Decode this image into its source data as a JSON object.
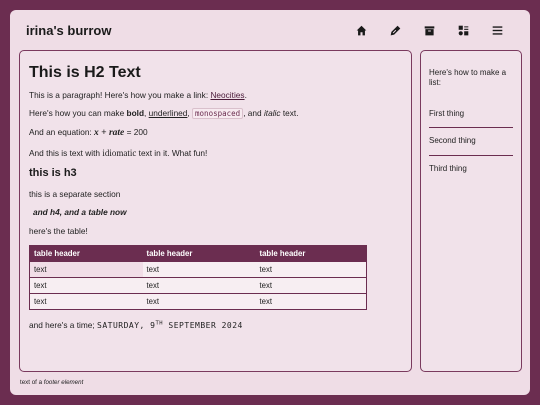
{
  "header": {
    "site_title": "irina's burrow",
    "nav": [
      "home-icon",
      "pen-icon",
      "archive-icon",
      "shapes-icon",
      "menu-icon"
    ]
  },
  "main": {
    "h2": "This is H2 Text",
    "p1_prefix": "This is a paragraph! Here's how you make a link: ",
    "p1_link": "Neocities",
    "p1_suffix": ".",
    "p2_prefix": "Here's how you can make ",
    "p2_bold": "bold",
    "p2_sep1": ", ",
    "p2_underline": "underlined",
    "p2_sep2": ", ",
    "p2_mono": "monospaced",
    "p2_sep3": ", and ",
    "p2_italic": "italic",
    "p2_suffix": " text.",
    "p3_prefix": "And an equation: ",
    "p3_math": "x + rate",
    "p3_suffix": " = 200",
    "p4_prefix": "And this is text with ",
    "p4_serif": "idiomatic",
    "p4_suffix": " text in it. What fun!",
    "h3": "this is h3",
    "p5": "this is a separate section",
    "h4": "and h4, and a table now",
    "p6": "here's the table!",
    "table": {
      "headers": [
        "table header",
        "table header",
        "table header"
      ],
      "rows": [
        [
          "text",
          "text",
          "text"
        ],
        [
          "text",
          "text",
          "text"
        ],
        [
          "text",
          "text",
          "text"
        ]
      ]
    },
    "time_prefix": "and here's a time; ",
    "time_a": "SATURDAY, 9",
    "time_sup": "TH",
    "time_b": " SEPTEMBER 2024"
  },
  "aside": {
    "intro": "Here's how to make a list:",
    "items": [
      "First thing",
      "Second thing",
      "Third thing"
    ]
  },
  "footer": {
    "prefix": "text of a ",
    "italic": "footer element"
  }
}
